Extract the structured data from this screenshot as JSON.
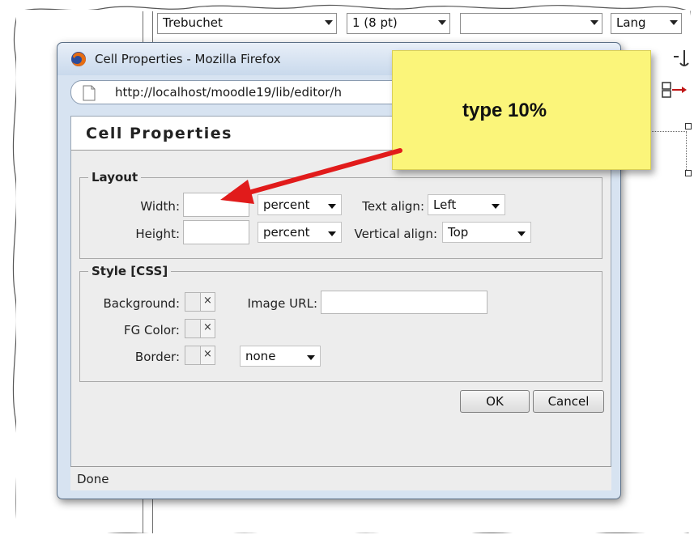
{
  "toolbar": {
    "font_value": "Trebuchet",
    "size_value": "1 (8 pt)",
    "heading_value": "",
    "lang_value": "Lang"
  },
  "window": {
    "title": "Cell Properties - Mozilla Firefox",
    "url": "http://localhost/moodle19/lib/editor/h",
    "status": "Done"
  },
  "dialog": {
    "heading": "Cell Properties",
    "layout": {
      "legend": "Layout",
      "width_label": "Width:",
      "width_value": "",
      "width_unit": "percent",
      "height_label": "Height:",
      "height_value": "",
      "height_unit": "percent",
      "text_align_label": "Text align:",
      "text_align_value": "Left",
      "vertical_align_label": "Vertical align:",
      "vertical_align_value": "Top"
    },
    "style": {
      "legend": "Style [CSS]",
      "background_label": "Background:",
      "image_url_label": "Image URL:",
      "image_url_value": "",
      "fg_color_label": "FG Color:",
      "border_label": "Border:",
      "border_value": "none",
      "clear_glyph": "×"
    },
    "buttons": {
      "ok": "OK",
      "cancel": "Cancel"
    }
  },
  "callout": {
    "text": "type 10%"
  },
  "colors": {
    "dialog_frame": "#d7e3f1",
    "callout_bg": "#fbf57a",
    "arrow": "#e11b1b"
  }
}
